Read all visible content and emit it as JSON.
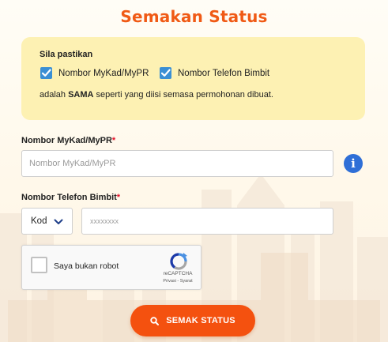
{
  "page": {
    "title": "Semakan Status"
  },
  "notice": {
    "heading": "Sila pastikan",
    "items": [
      "Nombor MyKad/MyPR",
      "Nombor Telefon Bimbit"
    ],
    "note_prefix": "adalah ",
    "note_bold": "SAMA",
    "note_suffix": " seperti yang diisi semasa permohonan dibuat."
  },
  "form": {
    "ic_label": "Nombor MyKad/MyPR",
    "ic_placeholder": "Nombor MyKad/MyPR",
    "phone_label": "Nombor Telefon Bimbit",
    "code_selected": "Kod",
    "phone_placeholder": "xxxxxxxx",
    "required_mark": "*",
    "info_glyph": "i"
  },
  "captcha": {
    "label": "Saya bukan robot",
    "brand": "reCAPTCHA",
    "links": "Privasi - Syarat"
  },
  "submit": {
    "label": "SEMAK STATUS"
  },
  "colors": {
    "title": "#f05a15",
    "notice_bg": "#fdf1b3",
    "checkbox": "#3a8fd4",
    "info": "#2f6fd7",
    "button": "#f4510f",
    "required": "#e4102a"
  },
  "icons": {
    "check": "check-icon",
    "info": "info-icon",
    "chevron": "chevron-down-icon",
    "search": "search-icon",
    "recaptcha": "recaptcha-logo-icon"
  }
}
